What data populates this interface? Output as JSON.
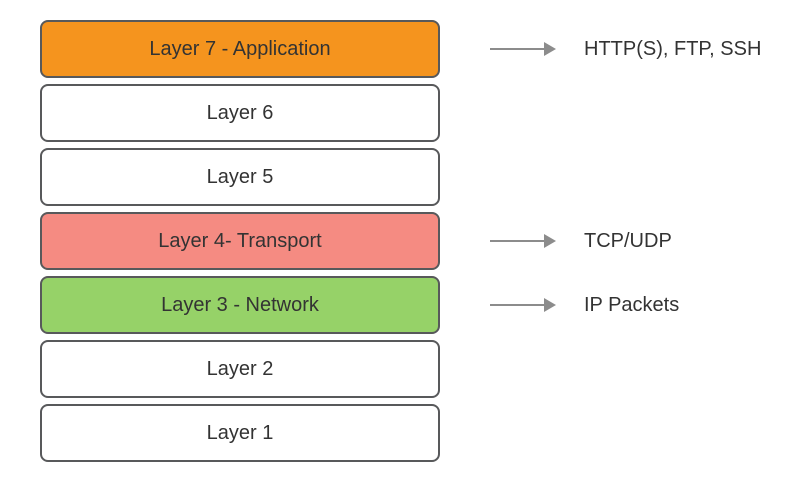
{
  "layers": [
    {
      "label": "Layer 7 - Application",
      "color": "orange",
      "annotation": "HTTP(S), FTP, SSH"
    },
    {
      "label": "Layer 6",
      "color": "none",
      "annotation": null
    },
    {
      "label": "Layer 5",
      "color": "none",
      "annotation": null
    },
    {
      "label": "Layer 4- Transport",
      "color": "red",
      "annotation": "TCP/UDP"
    },
    {
      "label": "Layer 3 - Network",
      "color": "green",
      "annotation": "IP Packets"
    },
    {
      "label": "Layer 2",
      "color": "none",
      "annotation": null
    },
    {
      "label": "Layer 1",
      "color": "none",
      "annotation": null
    }
  ]
}
